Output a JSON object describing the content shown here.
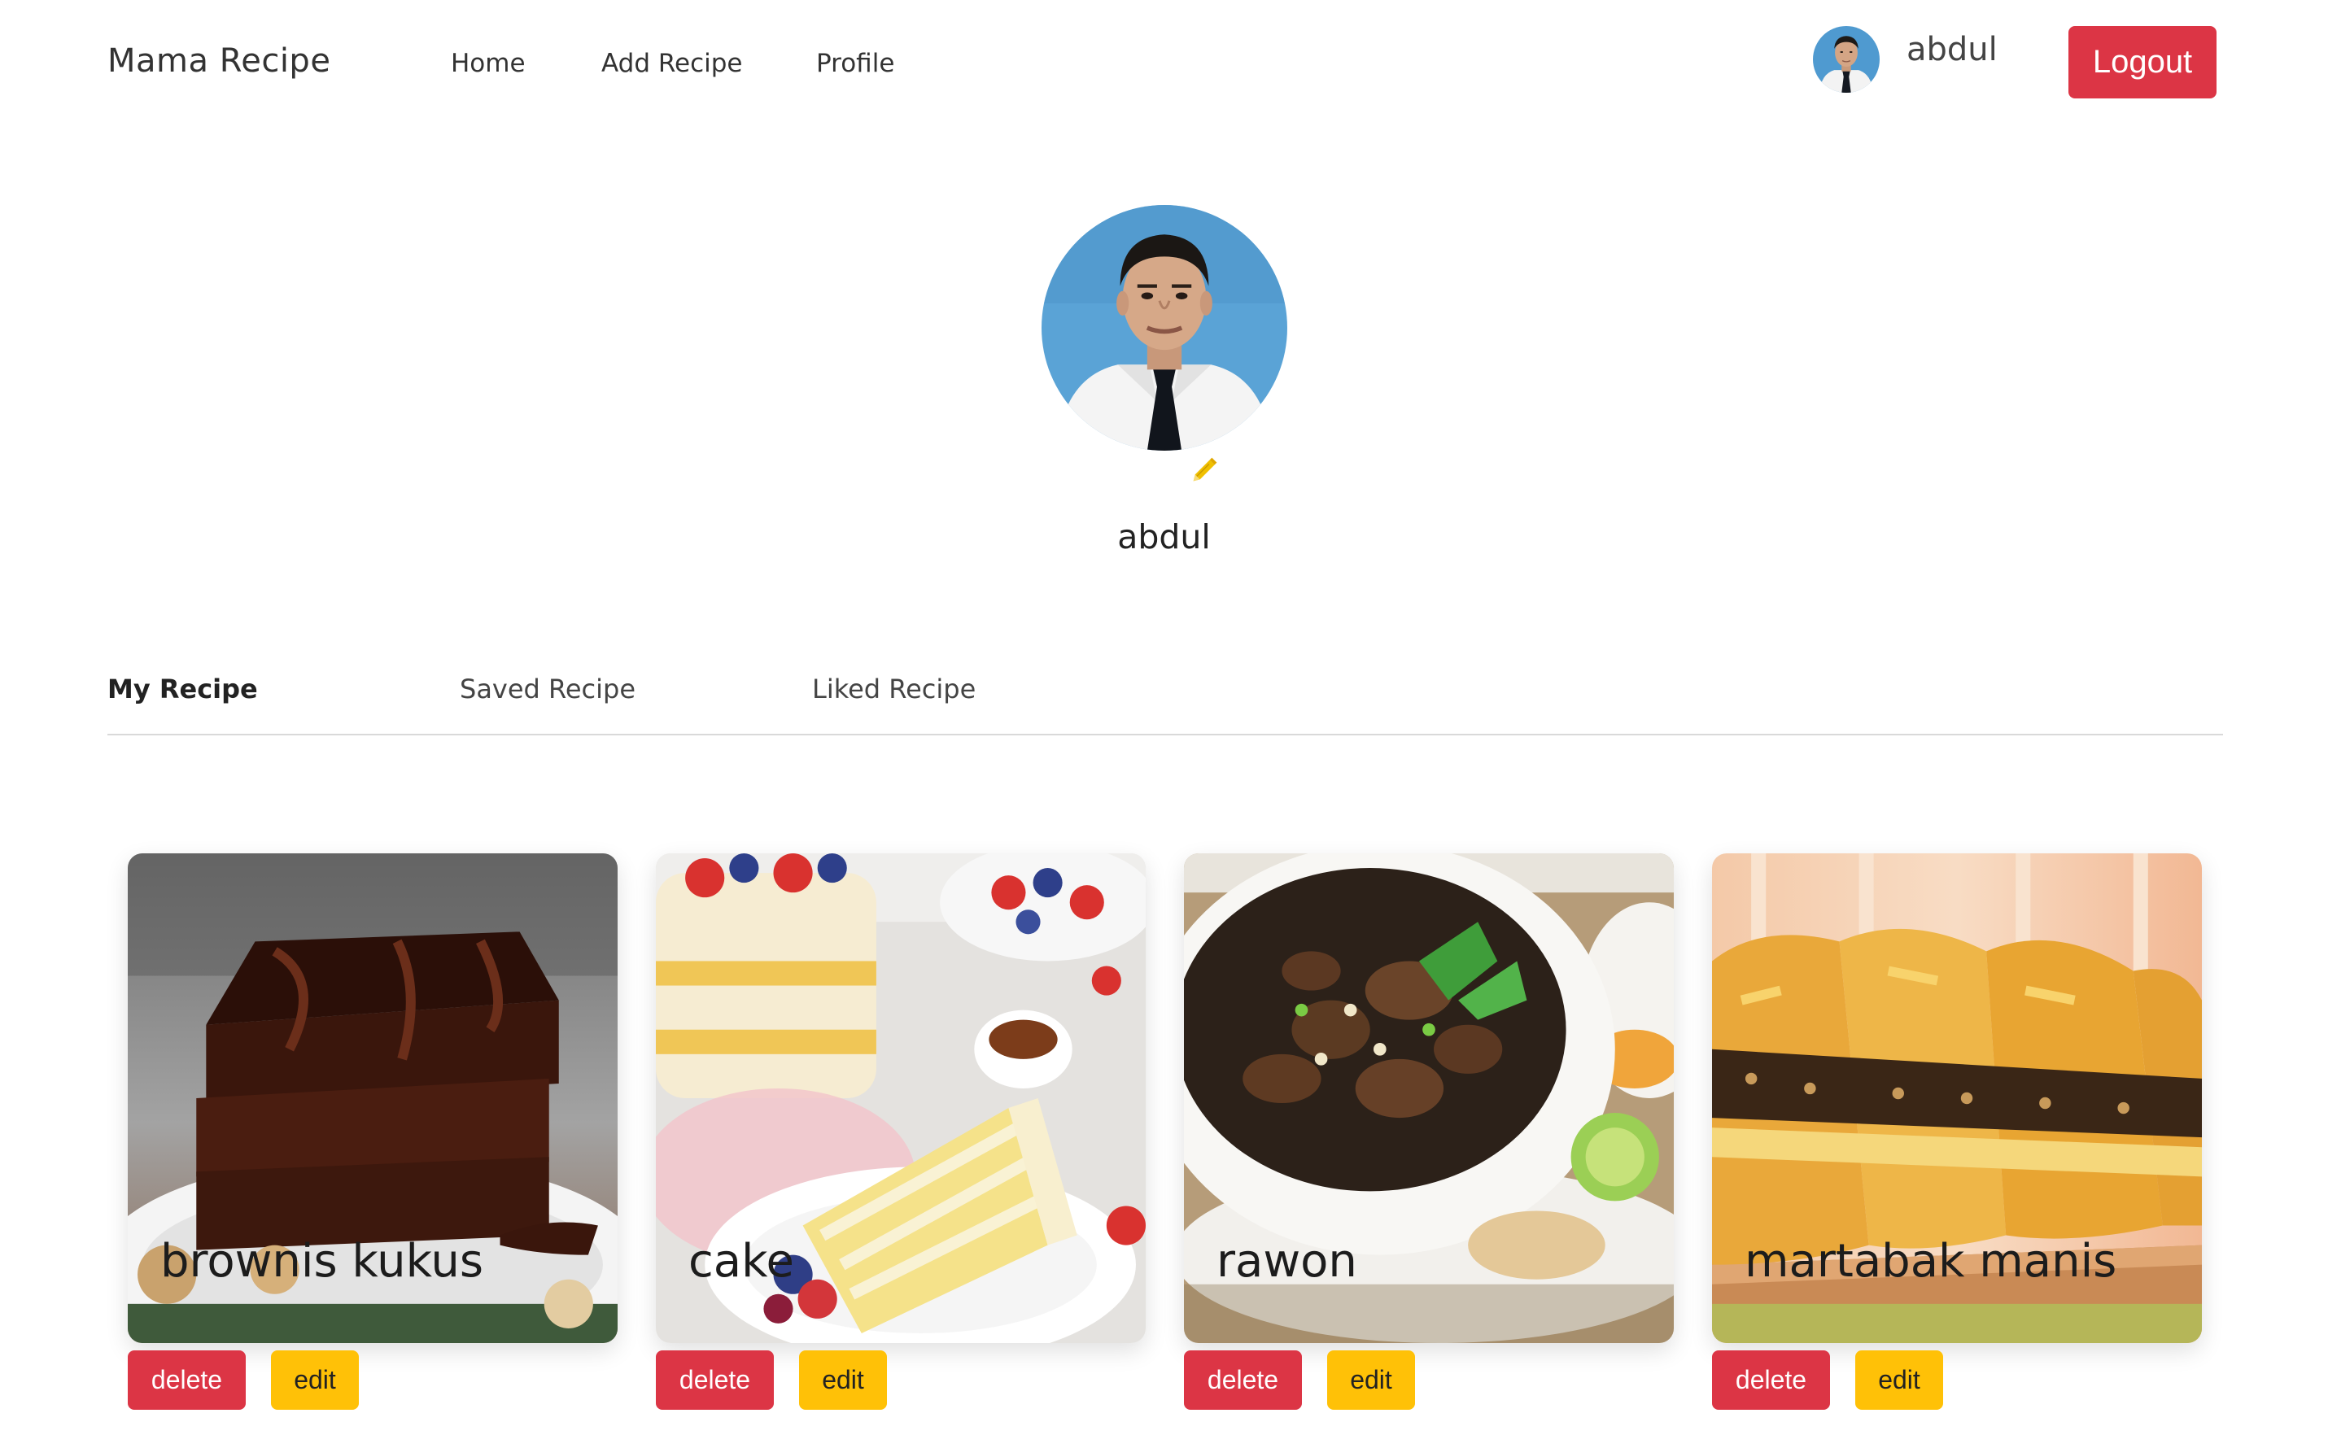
{
  "nav": {
    "brand": "Mama Recipe",
    "links": [
      "Home",
      "Add Recipe",
      "Profile"
    ],
    "username": "abdul",
    "logout_label": "Logout"
  },
  "profile": {
    "name": "abdul"
  },
  "tabs": [
    "My Recipe",
    "Saved Recipe",
    "Liked Recipe"
  ],
  "active_tab": "My Recipe",
  "recipes": [
    {
      "title": "brownis kukus",
      "delete_label": "delete",
      "edit_label": "edit"
    },
    {
      "title": "cake",
      "delete_label": "delete",
      "edit_label": "edit"
    },
    {
      "title": "rawon",
      "delete_label": "delete",
      "edit_label": "edit"
    },
    {
      "title": "martabak manis",
      "delete_label": "delete",
      "edit_label": "edit"
    }
  ],
  "colors": {
    "danger": "#dc3545",
    "warning": "#ffc107",
    "pencil": "#f0c000"
  },
  "icons": {
    "edit_profile": "pencil-icon"
  }
}
